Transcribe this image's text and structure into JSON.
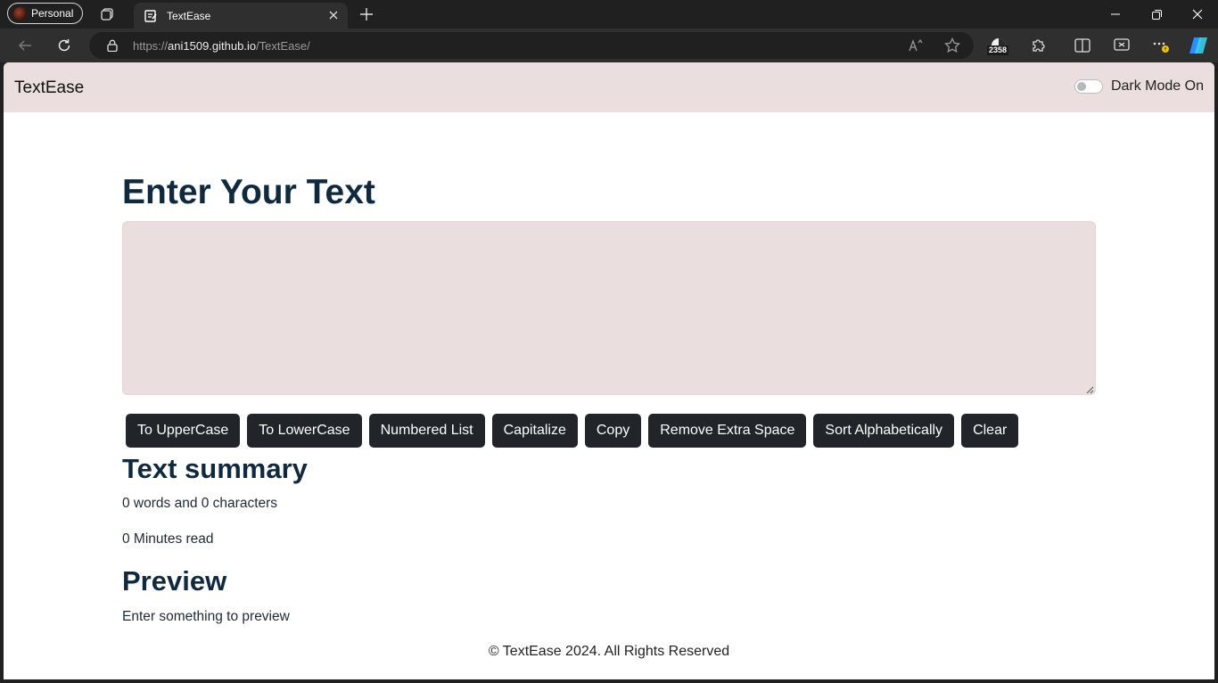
{
  "browser": {
    "profile_label": "Personal",
    "tab_title": "TextEase",
    "url_scheme": "https://",
    "url_host": "ani1509.github.io",
    "url_path": "/TextEase/",
    "extension_badge_count": "2358"
  },
  "navbar": {
    "brand": "TextEase",
    "dark_mode_label": "Dark Mode On",
    "dark_mode_enabled": false
  },
  "editor": {
    "heading": "Enter Your Text",
    "textarea_value": "",
    "buttons": {
      "uppercase": "To UpperCase",
      "lowercase": "To LowerCase",
      "numbered_list": "Numbered List",
      "capitalize": "Capitalize",
      "copy": "Copy",
      "remove_space": "Remove Extra Space",
      "sort": "Sort Alphabetically",
      "clear": "Clear"
    }
  },
  "summary": {
    "heading": "Text summary",
    "counts": "0 words and 0 characters",
    "read_time": "0 Minutes read"
  },
  "preview": {
    "heading": "Preview",
    "text": "Enter something to preview"
  },
  "footer": {
    "text": "© TextEase 2024. All Rights Reserved"
  },
  "colors": {
    "navbar_bg": "#eadede",
    "heading": "#0f2a3f",
    "button_bg": "#212529"
  }
}
